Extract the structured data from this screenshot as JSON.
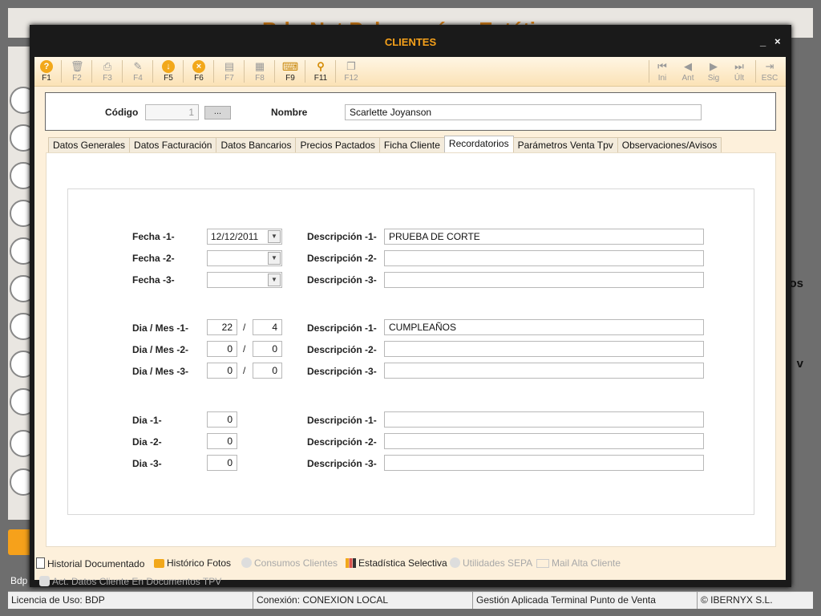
{
  "app": {
    "title": "Bdp-Net Peluquería y Estética",
    "bottom_left": "Bdp",
    "side_fragments": [
      "os",
      "v"
    ]
  },
  "status_bar": [
    "Licencia de Uso: BDP",
    "Conexión: CONEXION LOCAL",
    "Gestión Aplicada Terminal Punto de Venta",
    "© IBERNYX S.L."
  ],
  "window": {
    "title": "CLIENTES",
    "minimize": "_",
    "close": "×"
  },
  "toolbar": {
    "buttons": [
      {
        "key": "F1",
        "icon": "help-icon"
      },
      {
        "key": "F2",
        "icon": "trash-icon"
      },
      {
        "key": "F3",
        "icon": "print-icon"
      },
      {
        "key": "F4",
        "icon": "edit-icon"
      },
      {
        "key": "F5",
        "icon": "save-icon"
      },
      {
        "key": "F6",
        "icon": "cancel-icon"
      },
      {
        "key": "F7",
        "icon": "document-icon"
      },
      {
        "key": "F8",
        "icon": "calculator-icon"
      },
      {
        "key": "F9",
        "icon": "keyboard-icon"
      },
      {
        "key": "F11",
        "icon": "search-icon"
      },
      {
        "key": "F12",
        "icon": "copy-icon"
      }
    ],
    "nav": [
      {
        "label": "Ini",
        "icon": "first-icon"
      },
      {
        "label": "Ant",
        "icon": "previous-icon"
      },
      {
        "label": "Sig",
        "icon": "next-icon"
      },
      {
        "label": "Últ",
        "icon": "last-icon"
      },
      {
        "label": "ESC",
        "icon": "exit-icon"
      }
    ]
  },
  "header": {
    "codigo_label": "Código",
    "codigo_value": "1",
    "dots": "...",
    "nombre_label": "Nombre",
    "nombre_value": "Scarlette Joyanson"
  },
  "tabs": [
    "Datos Generales",
    "Datos Facturación",
    "Datos Bancarios",
    "Precios Pactados",
    "Ficha Cliente",
    "Recordatorios",
    "Parámetros Venta Tpv",
    "Observaciones/Avisos"
  ],
  "active_tab": "Recordatorios",
  "fechas": [
    {
      "label": "Fecha -1-",
      "value": "12/12/2011",
      "desc_label": "Descripción -1-",
      "desc": "PRUEBA DE CORTE"
    },
    {
      "label": "Fecha -2-",
      "value": "",
      "desc_label": "Descripción -2-",
      "desc": ""
    },
    {
      "label": "Fecha -3-",
      "value": "",
      "desc_label": "Descripción -3-",
      "desc": ""
    }
  ],
  "dia_mes": [
    {
      "label": "Dia / Mes -1-",
      "dia": "22",
      "mes": "4",
      "desc_label": "Descripción -1-",
      "desc": "CUMPLEAÑOS"
    },
    {
      "label": "Dia / Mes -2-",
      "dia": "0",
      "mes": "0",
      "desc_label": "Descripción -2-",
      "desc": ""
    },
    {
      "label": "Dia / Mes -3-",
      "dia": "0",
      "mes": "0",
      "desc_label": "Descripción -3-",
      "desc": ""
    }
  ],
  "dias": [
    {
      "label": "Dia -1-",
      "dia": "0",
      "desc_label": "Descripción -1-",
      "desc": ""
    },
    {
      "label": "Dia -2-",
      "dia": "0",
      "desc_label": "Descripción -2-",
      "desc": ""
    },
    {
      "label": "Dia -3-",
      "dia": "0",
      "desc_label": "Descripción -3-",
      "desc": ""
    }
  ],
  "slash": "/",
  "bottom_links": [
    {
      "label": "Historial Documentado",
      "icon": "document-icon",
      "enabled": true
    },
    {
      "label": "Histórico Fotos",
      "icon": "camera-icon",
      "enabled": true
    },
    {
      "label": "Consumos Clientes",
      "icon": "pie-chart-icon",
      "enabled": false
    },
    {
      "label": "Estadística Selectiva",
      "icon": "bar-chart-icon",
      "enabled": true
    },
    {
      "label": "Utilidades SEPA",
      "icon": "gear-icon",
      "enabled": false
    },
    {
      "label": "Mail Alta Cliente",
      "icon": "mail-icon",
      "enabled": false
    },
    {
      "label": "Act. Datos Cliente En Documentos TPV",
      "icon": "refresh-icon",
      "enabled": false
    }
  ],
  "colors": {
    "accent": "#f6a11b",
    "window_bg": "#1a1a1a",
    "panel_bg": "#fdf0db"
  }
}
